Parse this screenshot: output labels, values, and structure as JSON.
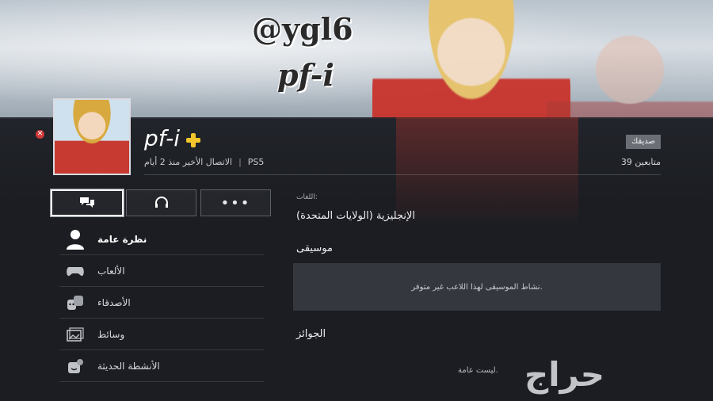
{
  "banner": {
    "watermark_line1": "@ygl6",
    "watermark_line2": "pf-i"
  },
  "profile": {
    "online_id": "pf-i",
    "platform": "PS5",
    "last_online": "الاتصال الأخير منذ 2 أيام",
    "relationship_badge": "صديقك",
    "followers": "39 متابعين"
  },
  "actions": {
    "message_icon": "message-icon",
    "voice_chat_icon": "headset-icon",
    "more_label": "•••"
  },
  "menu": {
    "items": [
      {
        "label": "نظرة عامة",
        "icon": "person-icon"
      },
      {
        "label": "الألعاب",
        "icon": "controller-icon"
      },
      {
        "label": "الأصدقاء",
        "icon": "friends-icon"
      },
      {
        "label": "وسائط",
        "icon": "media-icon"
      },
      {
        "label": "الأنشطة الحديثة",
        "icon": "activity-icon"
      }
    ]
  },
  "details": {
    "languages_label": "اللغات:",
    "languages_value": "الإنجليزية (الولايات المتحدة)",
    "music_title": "موسيقى",
    "music_empty": "نشاط الموسيقى لهذا اللاعب غير متوفر.",
    "trophies_title": "الجوائز",
    "trophies_note": "ليست عامة."
  },
  "site_watermark": "حراج",
  "colors": {
    "plus_gold": "#f2c52c",
    "remove_red": "#d23b3b"
  }
}
